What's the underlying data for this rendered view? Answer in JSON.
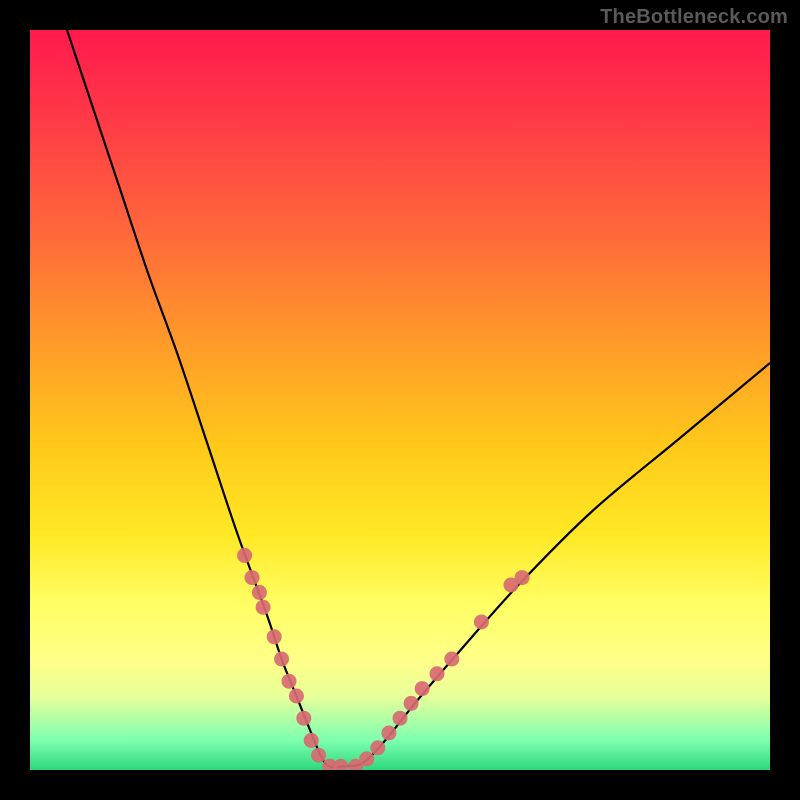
{
  "attribution": "TheBottleneck.com",
  "chart_data": {
    "type": "line",
    "title": "",
    "xlabel": "",
    "ylabel": "",
    "xlim": [
      0,
      100
    ],
    "ylim": [
      0,
      100
    ],
    "series": [
      {
        "name": "bottleneck-curve",
        "x": [
          5,
          8,
          12,
          16,
          20,
          24,
          28,
          32,
          34,
          36,
          38,
          39.5,
          40.5,
          42.5,
          45,
          48,
          52,
          58,
          66,
          76,
          88,
          100
        ],
        "y": [
          100,
          91,
          79,
          67,
          56,
          44,
          32,
          21,
          15,
          10,
          5,
          1.5,
          0.5,
          0.5,
          1,
          4,
          9,
          16,
          25,
          35,
          45,
          55
        ]
      }
    ],
    "markers": {
      "name": "highlight-dots",
      "color": "#d86a72",
      "points": [
        {
          "x": 29,
          "y": 29
        },
        {
          "x": 30,
          "y": 26
        },
        {
          "x": 31,
          "y": 24
        },
        {
          "x": 31.5,
          "y": 22
        },
        {
          "x": 33,
          "y": 18
        },
        {
          "x": 34,
          "y": 15
        },
        {
          "x": 35,
          "y": 12
        },
        {
          "x": 36,
          "y": 10
        },
        {
          "x": 37,
          "y": 7
        },
        {
          "x": 38,
          "y": 4
        },
        {
          "x": 39,
          "y": 2
        },
        {
          "x": 40.5,
          "y": 0.5
        },
        {
          "x": 42,
          "y": 0.5
        },
        {
          "x": 44,
          "y": 0.5
        },
        {
          "x": 45.5,
          "y": 1.5
        },
        {
          "x": 47,
          "y": 3
        },
        {
          "x": 48.5,
          "y": 5
        },
        {
          "x": 50,
          "y": 7
        },
        {
          "x": 51.5,
          "y": 9
        },
        {
          "x": 53,
          "y": 11
        },
        {
          "x": 55,
          "y": 13
        },
        {
          "x": 57,
          "y": 15
        },
        {
          "x": 61,
          "y": 20
        },
        {
          "x": 65,
          "y": 25
        },
        {
          "x": 66.5,
          "y": 26
        }
      ]
    }
  }
}
